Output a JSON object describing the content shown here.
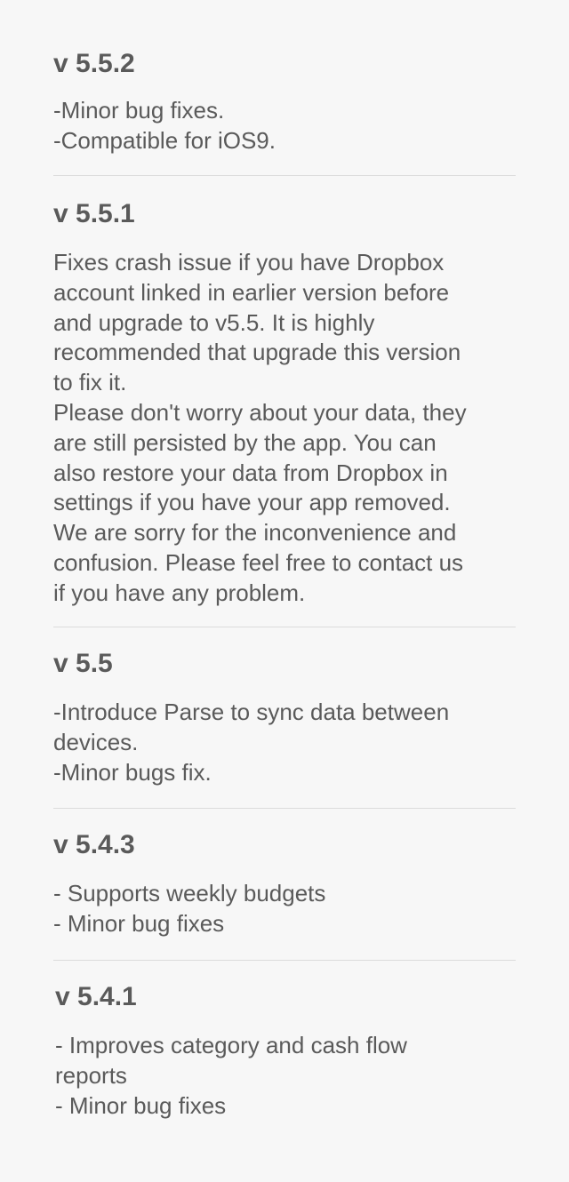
{
  "releases": [
    {
      "version": "v 5.5.2",
      "lines": [
        "-Minor bug fixes.",
        "-Compatible for iOS9."
      ]
    },
    {
      "version": "v 5.5.1",
      "lines": [
        "Fixes crash issue if you have Dropbox",
        "account linked in earlier version before",
        "and upgrade to v5.5. It is highly",
        "recommended that upgrade this version",
        "to fix it.",
        "Please don't worry about your data, they",
        "are still persisted by the app. You can",
        "also restore your data from Dropbox in",
        "settings if you have your app removed.",
        "We are sorry for the inconvenience and",
        "confusion. Please feel free to contact us",
        "if you have any problem."
      ]
    },
    {
      "version": "v 5.5",
      "lines": [
        "-Introduce Parse to sync data between",
        "devices.",
        "-Minor bugs fix."
      ]
    },
    {
      "version": "v 5.4.3",
      "lines": [
        "- Supports weekly budgets",
        "- Minor bug fixes"
      ]
    },
    {
      "version": "v 5.4.1",
      "lines": [
        "- Improves category and cash flow",
        "reports",
        "- Minor bug fixes"
      ]
    }
  ]
}
